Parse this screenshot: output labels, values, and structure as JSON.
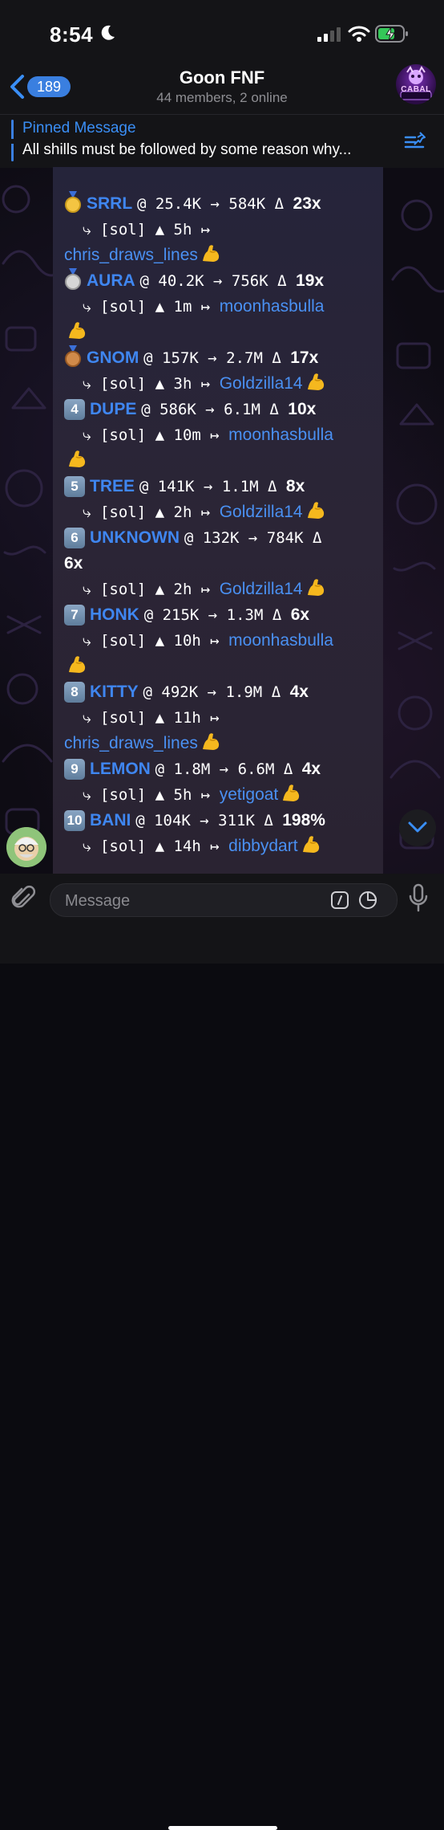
{
  "status_bar": {
    "time": "8:54"
  },
  "header": {
    "back_count": "189",
    "title": "Goon FNF",
    "subtitle": "44 members, 2 online",
    "avatar_text": "CABAL"
  },
  "pinned": {
    "title": "Pinned Message",
    "text": "All shills must be followed by some reason why..."
  },
  "message": {
    "entries": [
      {
        "rank": "medal-gold",
        "ticker": "SRRL",
        "entry": "@ 25.4K",
        "exit": "584K",
        "mult": "23x",
        "chain": "[sol]",
        "age": "5h",
        "user": "chris_draws_lines"
      },
      {
        "rank": "medal-silver",
        "ticker": "AURA",
        "entry": "@ 40.2K",
        "exit": "756K",
        "mult": "19x",
        "chain": "[sol]",
        "age": "1m",
        "user": "moonhasbulla"
      },
      {
        "rank": "medal-bronze",
        "ticker": "GNOM",
        "entry": "@ 157K",
        "exit": "2.7M",
        "mult": "17x",
        "chain": "[sol]",
        "age": "3h",
        "user": "Goldzilla14"
      },
      {
        "rank": "4",
        "ticker": "DUPE",
        "entry": "@ 586K",
        "exit": "6.1M",
        "mult": "10x",
        "chain": "[sol]",
        "age": "10m",
        "user": "moonhasbulla"
      },
      {
        "rank": "5",
        "ticker": "TREE",
        "entry": "@ 141K",
        "exit": "1.1M",
        "mult": "8x",
        "chain": "[sol]",
        "age": "2h",
        "user": "Goldzilla14"
      },
      {
        "rank": "6",
        "ticker": "UNKNOWN",
        "entry": "@ 132K",
        "exit": "784K",
        "mult": "6x",
        "chain": "[sol]",
        "age": "2h",
        "user": "Goldzilla14"
      },
      {
        "rank": "7",
        "ticker": "HONK",
        "entry": "@ 215K",
        "exit": "1.3M",
        "mult": "6x",
        "chain": "[sol]",
        "age": "10h",
        "user": "moonhasbulla"
      },
      {
        "rank": "8",
        "ticker": "KITTY",
        "entry": "@ 492K",
        "exit": "1.9M",
        "mult": "4x",
        "chain": "[sol]",
        "age": "11h",
        "user": "chris_draws_lines"
      },
      {
        "rank": "9",
        "ticker": "LEMON",
        "entry": "@ 1.8M",
        "exit": "6.6M",
        "mult": "4x",
        "chain": "[sol]",
        "age": "5h",
        "user": "yetigoat"
      },
      {
        "rank": "10",
        "ticker": "BANI",
        "entry": "@ 104K",
        "exit": "311K",
        "mult": "198%",
        "chain": "[sol]",
        "age": "14h",
        "user": "dibbydart"
      }
    ]
  },
  "composer": {
    "placeholder": "Message"
  },
  "colors": {
    "accent": "#3a7fe0",
    "link": "#4a90f2",
    "ticker": "#3f86f0"
  }
}
